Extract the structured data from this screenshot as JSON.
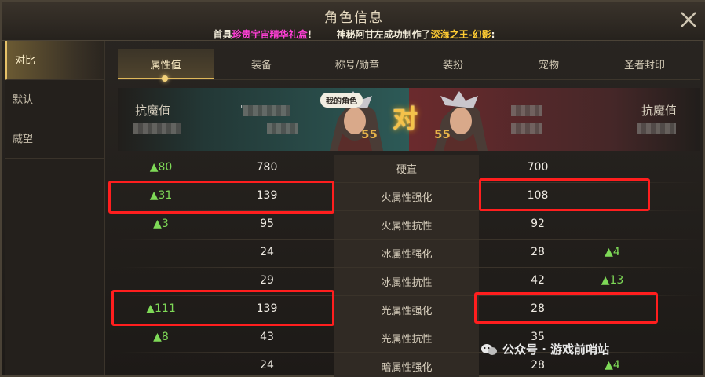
{
  "window": {
    "title": "角色信息",
    "notice_prefix": "首具",
    "notice_item": "珍贵宇宙精华礼盒",
    "notice_mid": "！      神秘阿甘左成功制作了",
    "notice_result": "深海之王-幻影",
    "notice_suffix": ":",
    "close_icon": "close-icon"
  },
  "sidebar": {
    "items": [
      {
        "label": "对比"
      },
      {
        "label": "默认"
      },
      {
        "label": "威望"
      }
    ]
  },
  "tabs": [
    {
      "label": "属性值"
    },
    {
      "label": "装备"
    },
    {
      "label": "称号/勋章"
    },
    {
      "label": "装扮"
    },
    {
      "label": "宠物"
    },
    {
      "label": "圣者封印"
    }
  ],
  "banner": {
    "left_stat_label": "抗魔值",
    "right_stat_label": "抗魔值",
    "my_char_badge": "我的角色",
    "vs_label": "对",
    "left_level": "55",
    "right_level": "55",
    "left_name_prefix": "'",
    "colors": {
      "left_bg": "#2d5a57",
      "right_bg": "#6b2a2d",
      "vs": "#f4c24a"
    }
  },
  "rows": [
    {
      "diffL": "▲80",
      "valL": "780",
      "name": "硬直",
      "valR": "700",
      "diffR": ""
    },
    {
      "diffL": "▲31",
      "valL": "139",
      "name": "火属性强化",
      "valR": "108",
      "diffR": ""
    },
    {
      "diffL": "▲3",
      "valL": "95",
      "name": "火属性抗性",
      "valR": "92",
      "diffR": ""
    },
    {
      "diffL": "",
      "valL": "24",
      "name": "冰属性强化",
      "valR": "28",
      "diffR": "▲4"
    },
    {
      "diffL": "",
      "valL": "29",
      "name": "冰属性抗性",
      "valR": "42",
      "diffR": "▲13"
    },
    {
      "diffL": "▲111",
      "valL": "139",
      "name": "光属性强化",
      "valR": "28",
      "diffR": ""
    },
    {
      "diffL": "▲8",
      "valL": "43",
      "name": "光属性抗性",
      "valR": "35",
      "diffR": ""
    },
    {
      "diffL": "",
      "valL": "24",
      "name": "暗属性强化",
      "valR": "28",
      "diffR": "▲4"
    }
  ],
  "highlight_color": "#ff1e1e",
  "watermark": {
    "text": "公众号 · 游戏前哨站",
    "icon": "wechat-icon"
  }
}
